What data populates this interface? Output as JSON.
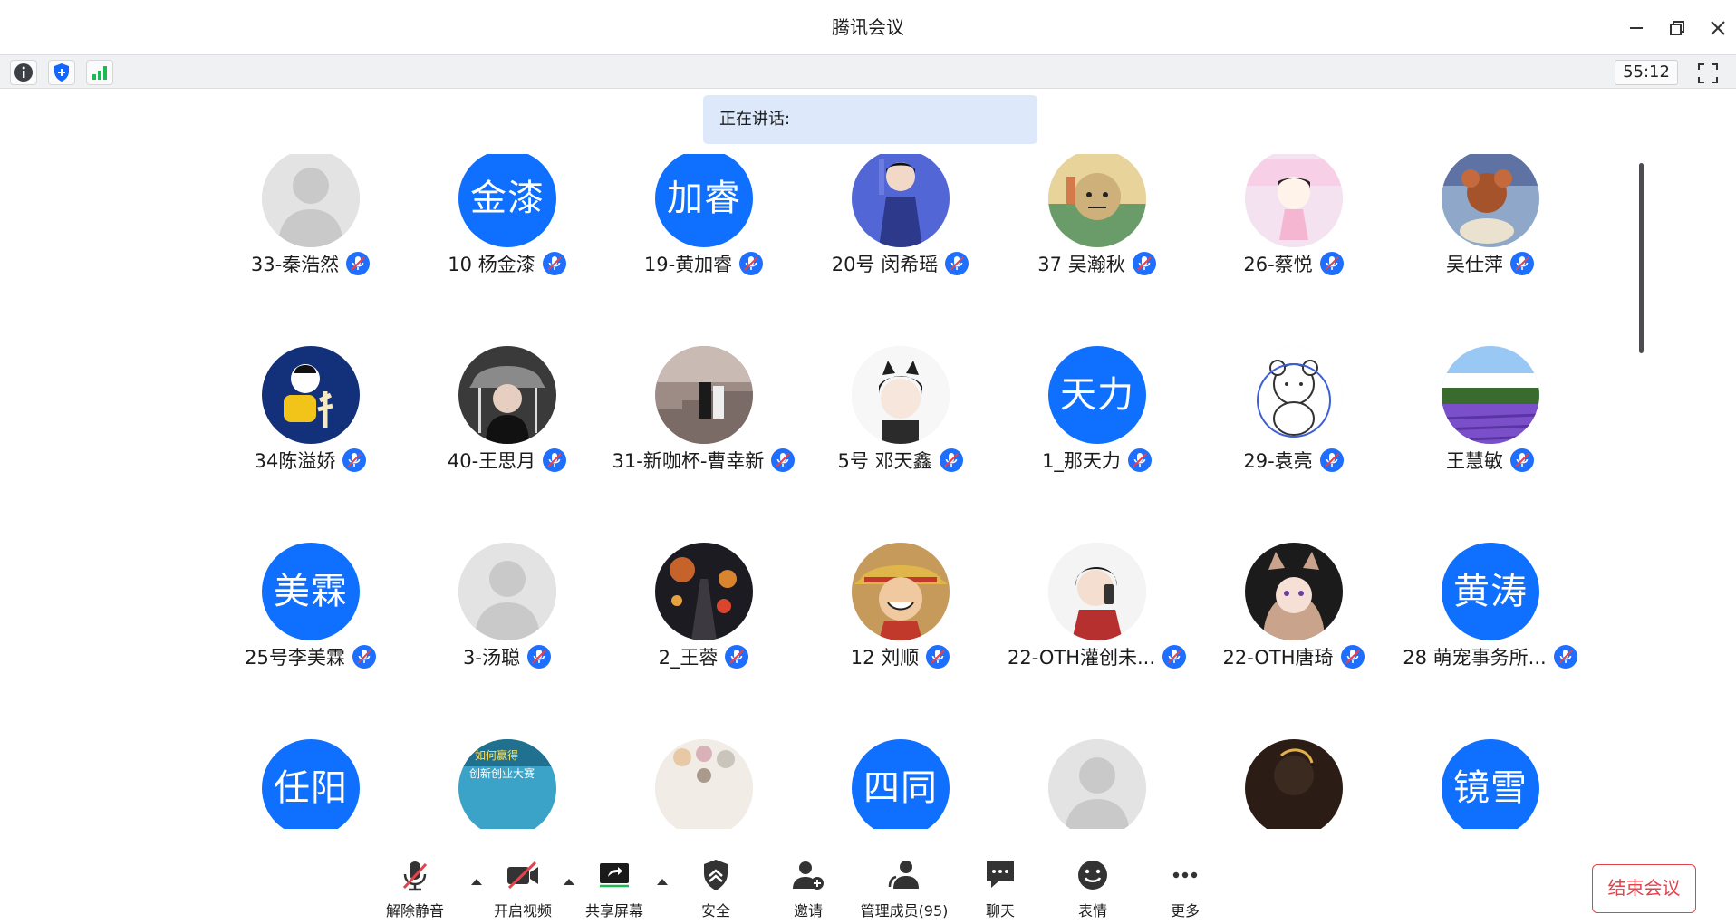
{
  "window": {
    "title": "腾讯会议"
  },
  "infobar": {
    "timer": "55:12"
  },
  "speaking": {
    "text": "正在讲话:"
  },
  "participants": [
    {
      "name": "33-秦浩然",
      "avatar": "silhouette"
    },
    {
      "name": "10 杨金漆",
      "avatar": "text",
      "avatar_text": "金漆"
    },
    {
      "name": "19-黄加睿",
      "avatar": "text",
      "avatar_text": "加睿"
    },
    {
      "name": "20号 闵希瑶",
      "avatar": "photo-anime-girl-blue"
    },
    {
      "name": "37 吴瀚秋",
      "avatar": "photo-cartoon-man"
    },
    {
      "name": "26-蔡悦",
      "avatar": "photo-cartoon-pink"
    },
    {
      "name": "吴仕萍",
      "avatar": "photo-cartoon-mouse"
    },
    {
      "name": "34陈溢娇",
      "avatar": "photo-cartoon-yellow"
    },
    {
      "name": "40-王思月",
      "avatar": "photo-person-hat"
    },
    {
      "name": "31-新咖杯-曹幸新",
      "avatar": "photo-stairs"
    },
    {
      "name": "5号 邓天鑫",
      "avatar": "photo-anime-boy-cat"
    },
    {
      "name": "1_那天力",
      "avatar": "text",
      "avatar_text": "天力"
    },
    {
      "name": "29-袁亮",
      "avatar": "photo-white-bear"
    },
    {
      "name": "王慧敏",
      "avatar": "photo-lavender"
    },
    {
      "name": "25号李美霖",
      "avatar": "text",
      "avatar_text": "美霖"
    },
    {
      "name": "3-汤聪",
      "avatar": "silhouette"
    },
    {
      "name": "2_王蓉",
      "avatar": "photo-street-night"
    },
    {
      "name": "12 刘顺",
      "avatar": "photo-luffy"
    },
    {
      "name": "22-OTH灌创未...",
      "avatar": "photo-anime-boy-phone"
    },
    {
      "name": "22-OTH唐琦",
      "avatar": "photo-anime-girl-cat"
    },
    {
      "name": "28 萌宠事务所...",
      "avatar": "text",
      "avatar_text": "黄涛"
    },
    {
      "name": "",
      "avatar": "text",
      "avatar_text": "任阳"
    },
    {
      "name": "",
      "avatar": "photo-poster"
    },
    {
      "name": "",
      "avatar": "photo-flowers"
    },
    {
      "name": "",
      "avatar": "text",
      "avatar_text": "四同"
    },
    {
      "name": "",
      "avatar": "silhouette"
    },
    {
      "name": "",
      "avatar": "photo-dark-person"
    },
    {
      "name": "",
      "avatar": "text",
      "avatar_text": "镜雪"
    }
  ],
  "toolbar": {
    "unmute": "解除静音",
    "start_video": "开启视频",
    "share_screen": "共享屏幕",
    "security": "安全",
    "invite": "邀请",
    "manage_members": "管理成员(95)",
    "chat": "聊天",
    "reactions": "表情",
    "more": "更多",
    "end_meeting": "结束会议"
  },
  "colors": {
    "accent": "#0f6fff",
    "danger": "#e3434c",
    "speaking_bg": "#dde9fb"
  }
}
